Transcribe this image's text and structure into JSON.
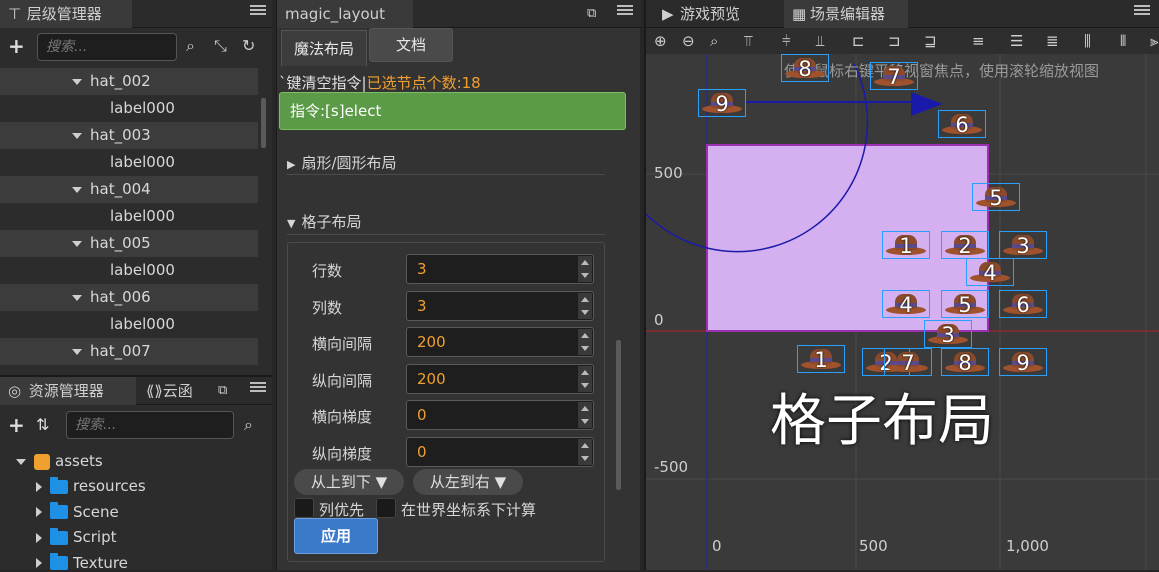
{
  "hierarchy": {
    "title": "层级管理器",
    "search_placeholder": "搜索...",
    "rows": [
      {
        "label": "hat_002",
        "type": "parent"
      },
      {
        "label": "label000",
        "type": "child"
      },
      {
        "label": "hat_003",
        "type": "parent"
      },
      {
        "label": "label000",
        "type": "child"
      },
      {
        "label": "hat_004",
        "type": "parent"
      },
      {
        "label": "label000",
        "type": "child"
      },
      {
        "label": "hat_005",
        "type": "parent"
      },
      {
        "label": "label000",
        "type": "child"
      },
      {
        "label": "hat_006",
        "type": "parent"
      },
      {
        "label": "label000",
        "type": "child"
      },
      {
        "label": "hat_007",
        "type": "parent"
      }
    ]
  },
  "assets": {
    "tab_title": "资源管理器",
    "tab2_title": "云函",
    "search_placeholder": "搜索...",
    "root": "assets",
    "folders": [
      "resources",
      "Scene",
      "Script",
      "Texture"
    ]
  },
  "magic": {
    "panel_title": "magic_layout",
    "tab_layout": "魔法布局",
    "tab_docs": "文档",
    "hint_prefix": "`键清空指令",
    "hint_sep": "|",
    "hint_selected": "已选节点个数:18",
    "command": "指令:[s]elect",
    "section_fan": "扇形/圆形布局",
    "section_grid": "格子布局",
    "fields": [
      {
        "label": "行数",
        "value": "3"
      },
      {
        "label": "列数",
        "value": "3"
      },
      {
        "label": "横向间隔",
        "value": "200"
      },
      {
        "label": "纵向间隔",
        "value": "200"
      },
      {
        "label": "横向梯度",
        "value": "0"
      },
      {
        "label": "纵向梯度",
        "value": "0"
      }
    ],
    "dir_vertical": "从上到下 ▼",
    "dir_horizontal": "从左到右 ▼",
    "check_col_first": "列优先",
    "check_world": "在世界坐标系下计算",
    "apply": "应用"
  },
  "scene": {
    "tab_preview": "游戏预览",
    "tab_editor": "场景编辑器",
    "hint": "使用鼠标右键平移视窗焦点，使用滚轮缩放视图",
    "overlay_text": "格子布局",
    "axis_y": [
      "500",
      "0",
      "-500"
    ],
    "axis_x": [
      "0",
      "500",
      "1,000"
    ],
    "hats": [
      "8",
      "7",
      "9",
      "6",
      "5",
      "1",
      "2",
      "3",
      "4",
      "4",
      "5",
      "6",
      "3",
      "1",
      "2",
      "7",
      "8",
      "9"
    ]
  },
  "colors": {
    "accent_green": "#5b9a47",
    "accent_orange": "#f0a030",
    "apply_blue": "#3b7ac8",
    "selection_blue": "#27a0ff",
    "canvas_fill": "#d4b0f0"
  }
}
